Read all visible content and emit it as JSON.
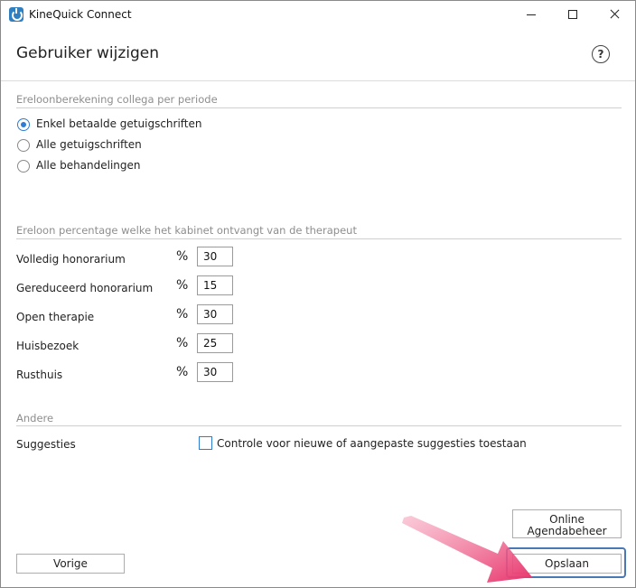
{
  "window": {
    "app_title": "KineQuick Connect",
    "icons": {
      "app": "kinequick-app-icon",
      "minimize": "minimize-icon",
      "maximize": "maximize-icon",
      "close": "close-icon",
      "help": "help-icon"
    }
  },
  "header": {
    "title": "Gebruiker wijzigen",
    "help_glyph": "?"
  },
  "section_ereloonberekening": {
    "title": "Ereloonberekening collega per periode",
    "options": [
      {
        "label": "Enkel betaalde getuigschriften",
        "checked": true
      },
      {
        "label": "Alle getuigschriften",
        "checked": false
      },
      {
        "label": "Alle behandelingen",
        "checked": false
      }
    ]
  },
  "section_percentage": {
    "title": "Ereloon percentage welke het kabinet ontvangt van de therapeut",
    "percent_symbol": "%",
    "fields": [
      {
        "label": "Volledig honorarium",
        "value": "30"
      },
      {
        "label": "Gereduceerd honorarium",
        "value": "15"
      },
      {
        "label": "Open therapie",
        "value": "30"
      },
      {
        "label": "Huisbezoek",
        "value": "25"
      },
      {
        "label": "Rusthuis",
        "value": "30"
      }
    ]
  },
  "section_andere": {
    "title": "Andere",
    "suggesties_label": "Suggesties",
    "checkbox_label": "Controle voor nieuwe of aangepaste suggesties toestaan",
    "checkbox_checked": false
  },
  "buttons": {
    "agenda_line1": "Online",
    "agenda_line2": "Agendabeheer",
    "vorige": "Vorige",
    "opslaan": "Opslaan"
  },
  "colors": {
    "accent": "#2d7dd2",
    "annotation_arrow": "#e8336b",
    "focus_border": "#4a78b5"
  }
}
